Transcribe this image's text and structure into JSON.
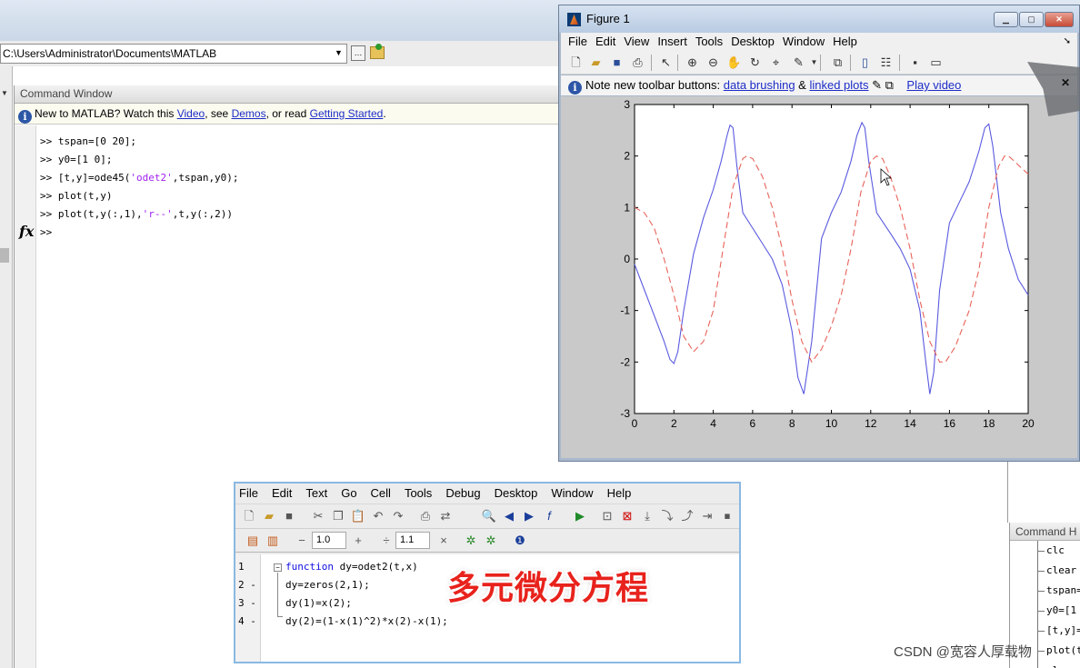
{
  "desktop": {
    "current_folder": "C:\\Users\\Administrator\\Documents\\MATLAB"
  },
  "command_window": {
    "title": "Command Window",
    "info_prefix": "New to MATLAB? Watch this ",
    "info_video": "Video",
    "info_mid1": ", see ",
    "info_demos": "Demos",
    "info_mid2": ", or read ",
    "info_getting_started": "Getting Started",
    "info_suffix": ".",
    "lines": [
      {
        "pre": ">> tspan=[0 20];",
        "str": "",
        "post": ""
      },
      {
        "pre": ">> y0=[1 0];",
        "str": "",
        "post": ""
      },
      {
        "pre": ">> [t,y]=ode45(",
        "str": "'odet2'",
        "post": ",tspan,y0);"
      },
      {
        "pre": ">> plot(t,y)",
        "str": "",
        "post": ""
      },
      {
        "pre": ">> plot(t,y(:,1),",
        "str": "'r--'",
        "post": ",t,y(:,2))"
      }
    ],
    "prompt": ">>",
    "fx_icon": "fx"
  },
  "figure": {
    "title": "Figure 1",
    "menu": [
      "File",
      "Edit",
      "View",
      "Insert",
      "Tools",
      "Desktop",
      "Window",
      "Help"
    ],
    "toolbar_icons": [
      "new-icon",
      "open-icon",
      "save-icon",
      "print-icon",
      "pointer-icon",
      "zoom-in-icon",
      "zoom-out-icon",
      "pan-icon",
      "rotate-icon",
      "data-cursor-icon",
      "brush-icon",
      "link-icon",
      "colorbar-icon",
      "legend-icon",
      "hide-tools-icon",
      "show-tools-icon"
    ],
    "note_text": "Note new toolbar buttons: ",
    "note_link1": "data brushing",
    "note_amp": " & ",
    "note_link2": "linked plots",
    "note_link3": "Play video"
  },
  "chart_data": {
    "type": "line",
    "title": "",
    "xlabel": "",
    "ylabel": "",
    "xlim": [
      0,
      20
    ],
    "ylim": [
      -3,
      3
    ],
    "x_ticks": [
      "0",
      "2",
      "4",
      "6",
      "8",
      "10",
      "12",
      "14",
      "16",
      "18",
      "20"
    ],
    "y_ticks": [
      "3",
      "2",
      "1",
      "0",
      "-1",
      "-2",
      "-3"
    ],
    "grid": false,
    "series": [
      {
        "style": "solid",
        "color": "#5a5ae0",
        "x": [
          0,
          0.5,
          1.0,
          1.5,
          1.8,
          2.0,
          2.2,
          2.5,
          3.0,
          3.5,
          4.0,
          4.4,
          4.7,
          4.85,
          5.0,
          5.2,
          5.5,
          6.0,
          6.5,
          7.0,
          7.5,
          8.0,
          8.3,
          8.6,
          9.0,
          9.5,
          10.0,
          10.5,
          11.0,
          11.3,
          11.55,
          11.7,
          11.9,
          12.3,
          13.0,
          13.5,
          14.0,
          14.5,
          14.8,
          15.0,
          15.2,
          15.5,
          16.0,
          16.5,
          17.0,
          17.5,
          17.8,
          18.0,
          18.2,
          18.6,
          19.0,
          19.5,
          20.0
        ],
        "y": [
          -0.1,
          -0.6,
          -1.1,
          -1.6,
          -1.95,
          -2.03,
          -1.8,
          -1.0,
          0.1,
          0.8,
          1.35,
          1.9,
          2.4,
          2.6,
          2.55,
          1.8,
          0.9,
          0.6,
          0.3,
          0.0,
          -0.5,
          -1.4,
          -2.3,
          -2.62,
          -1.6,
          0.4,
          0.9,
          1.3,
          1.9,
          2.4,
          2.65,
          2.55,
          1.9,
          0.9,
          0.5,
          0.2,
          -0.2,
          -1.0,
          -2.0,
          -2.62,
          -2.2,
          -0.6,
          0.7,
          1.1,
          1.5,
          2.1,
          2.55,
          2.62,
          2.2,
          0.9,
          0.2,
          -0.4,
          -0.7
        ]
      },
      {
        "style": "dashed",
        "color": "#e8635a",
        "x": [
          0,
          0.5,
          1.0,
          1.5,
          2.0,
          2.5,
          3.0,
          3.5,
          4.0,
          4.5,
          5.0,
          5.5,
          5.7,
          6.0,
          6.5,
          7.0,
          7.5,
          8.0,
          8.5,
          9.0,
          9.5,
          10.0,
          10.5,
          11.0,
          11.5,
          12.0,
          12.3,
          12.6,
          13.0,
          13.5,
          14.0,
          14.5,
          15.0,
          15.5,
          15.8,
          16.3,
          17.0,
          17.5,
          18.0,
          18.5,
          18.8,
          19.0,
          19.3,
          19.7,
          20.0
        ],
        "y": [
          1.0,
          0.9,
          0.6,
          0.0,
          -0.7,
          -1.5,
          -1.8,
          -1.6,
          -1.0,
          0.2,
          1.4,
          1.95,
          2.0,
          1.95,
          1.6,
          1.0,
          0.2,
          -0.8,
          -1.6,
          -2.0,
          -1.75,
          -1.3,
          -0.7,
          0.2,
          1.3,
          1.9,
          2.0,
          1.95,
          1.6,
          1.0,
          0.2,
          -0.8,
          -1.6,
          -2.0,
          -2.0,
          -1.7,
          -1.0,
          -0.2,
          1.0,
          1.8,
          2.0,
          2.0,
          1.9,
          1.75,
          1.65
        ]
      }
    ]
  },
  "editor": {
    "menu": [
      "File",
      "Edit",
      "Text",
      "Go",
      "Cell",
      "Tools",
      "Debug",
      "Desktop",
      "Window",
      "Help"
    ],
    "cell_minus": "−",
    "cell_value1": "1.0",
    "cell_plus": "+",
    "cell_divide": "÷",
    "cell_value2": "1.1",
    "cell_times": "×",
    "line_numbers": [
      "1",
      "2 -",
      "3 -",
      "4 -"
    ],
    "code": [
      {
        "kw": "function",
        "rest": " dy=odet2(t,x)"
      },
      {
        "kw": "",
        "rest": "dy=zeros(2,1);"
      },
      {
        "kw": "",
        "rest": "dy(1)=x(2);"
      },
      {
        "kw": "",
        "rest": "dy(2)=(1-x(1)^2)*x(2)-x(1);"
      }
    ],
    "caption": "多元微分方程"
  },
  "history": {
    "title": "Command H",
    "items": [
      "clc",
      "clear",
      "tspan=",
      "y0=[1",
      "[t,y]=",
      "plot(t",
      "clc"
    ]
  },
  "watermark": "CSDN @宽容人厚载物"
}
